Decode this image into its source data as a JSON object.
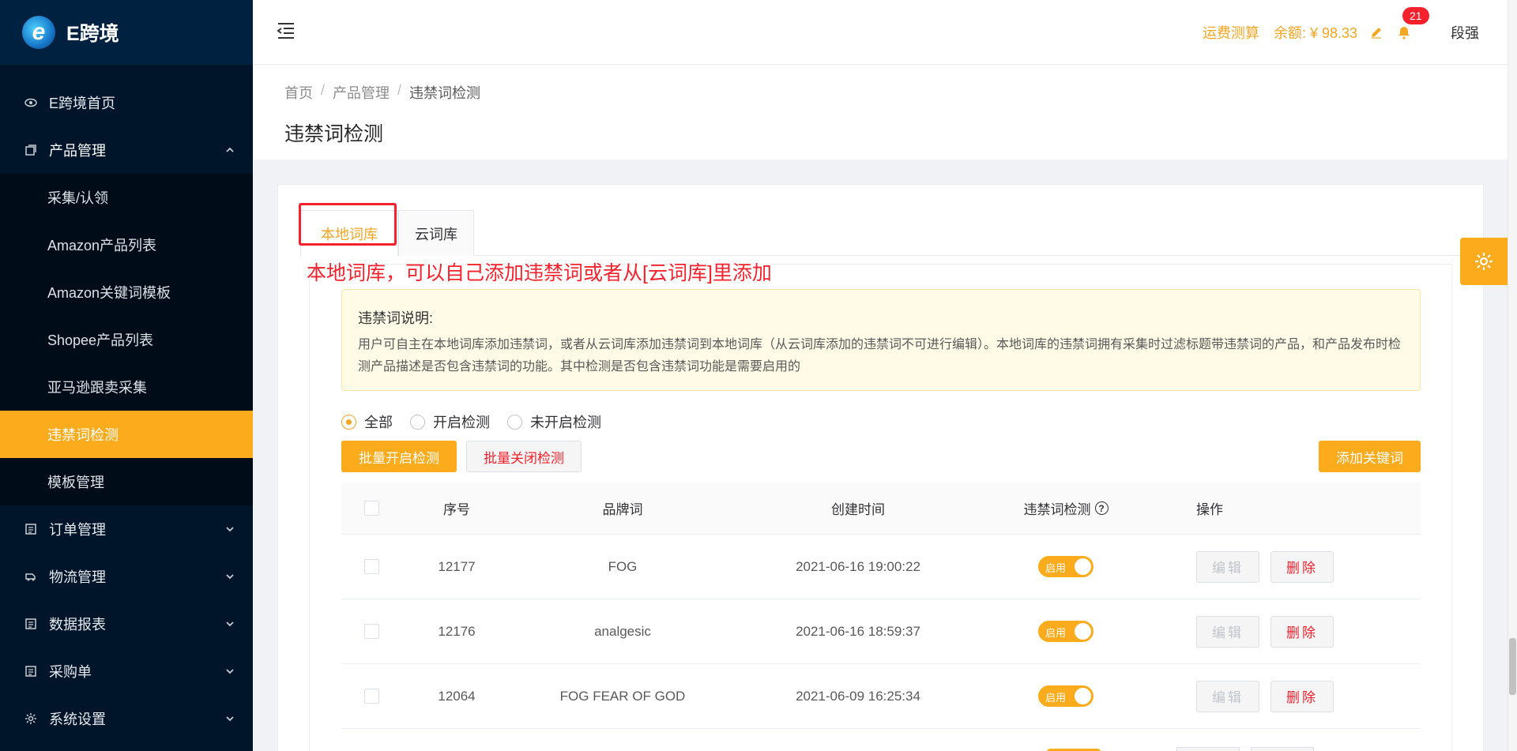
{
  "app": {
    "logo_text": "E跨境"
  },
  "sidebar": {
    "items": [
      {
        "label": "E跨境首页"
      },
      {
        "label": "产品管理"
      },
      {
        "label": "订单管理"
      },
      {
        "label": "物流管理"
      },
      {
        "label": "数据报表"
      },
      {
        "label": "采购单"
      },
      {
        "label": "系统设置"
      }
    ],
    "product_sub": [
      {
        "label": "采集/认领"
      },
      {
        "label": "Amazon产品列表"
      },
      {
        "label": "Amazon关键词模板"
      },
      {
        "label": "Shopee产品列表"
      },
      {
        "label": "亚马逊跟卖采集"
      },
      {
        "label": "违禁词检测"
      },
      {
        "label": "模板管理"
      }
    ]
  },
  "header": {
    "freight_link": "运费测算",
    "balance": "余额: ¥ 98.33",
    "notification_count": "21",
    "username": "段强"
  },
  "breadcrumb": {
    "home": "首页",
    "section": "产品管理",
    "current": "违禁词检测"
  },
  "page_title": "违禁词检测",
  "tabs": [
    {
      "label": "本地词库"
    },
    {
      "label": "云词库"
    }
  ],
  "annotation": "本地词库，可以自己添加违禁词或者从[云词库]里添加",
  "notice": {
    "title": "违禁词说明:",
    "text": "用户可自主在本地词库添加违禁词，或者从云词库添加违禁词到本地词库（从云词库添加的违禁词不可进行编辑）。本地词库的违禁词拥有采集时过滤标题带违禁词的产品，和产品发布时检测产品描述是否包含违禁词的功能。其中检测是否包含违禁词功能是需要启用的"
  },
  "filters": [
    {
      "label": "全部",
      "checked": true
    },
    {
      "label": "开启检测",
      "checked": false
    },
    {
      "label": "未开启检测",
      "checked": false
    }
  ],
  "actions": {
    "batch_enable": "批量开启检测",
    "batch_disable": "批量关闭检测",
    "add_keyword": "添加关键词"
  },
  "table": {
    "headers": {
      "id": "序号",
      "brand": "品牌词",
      "created": "创建时间",
      "detect": "违禁词检测",
      "ops": "操作"
    },
    "rows": [
      {
        "id": "12177",
        "brand": "FOG",
        "created": "2021-06-16 19:00:22",
        "switch_label": "启用",
        "edit": "编辑",
        "delete": "删除"
      },
      {
        "id": "12176",
        "brand": "analgesic",
        "created": "2021-06-16 18:59:37",
        "switch_label": "启用",
        "edit": "编辑",
        "delete": "删除"
      },
      {
        "id": "12064",
        "brand": "FOG FEAR OF GOD",
        "created": "2021-06-09 16:25:34",
        "switch_label": "启用",
        "edit": "编辑",
        "delete": "删除"
      }
    ]
  },
  "colors": {
    "accent": "#fbab1b",
    "sidebar_bg": "#001529",
    "danger": "#f5222d"
  }
}
